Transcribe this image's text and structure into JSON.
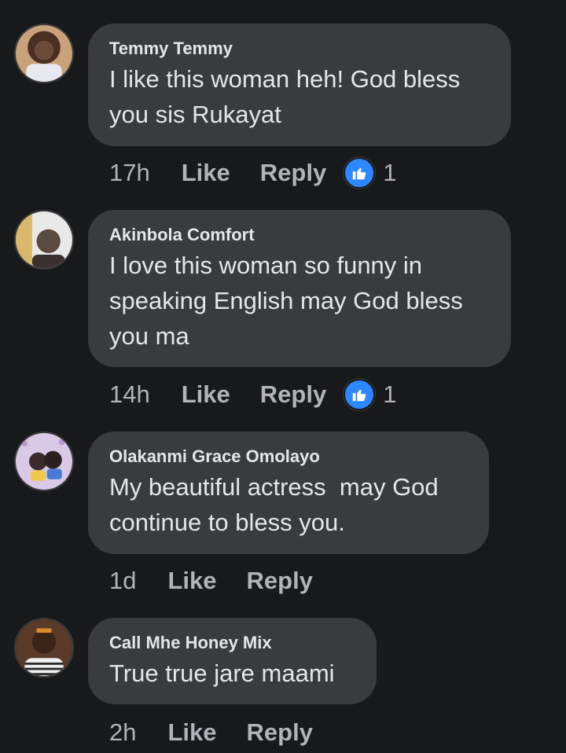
{
  "comments": [
    {
      "author": "Temmy Temmy",
      "text": "I like this woman heh! God bless\nyou sis Rukayat",
      "time": "17h",
      "like_label": "Like",
      "reply_label": "Reply",
      "reaction_icon": "like-reaction-icon",
      "reaction_count": "1",
      "avatar_colors": [
        "#6b4a3a",
        "#c9a27a"
      ]
    },
    {
      "author": "Akinbola Comfort",
      "text": "I love this woman so funny in\nspeaking English may God bless\nyou ma",
      "time": "14h",
      "like_label": "Like",
      "reply_label": "Reply",
      "reaction_icon": "like-reaction-icon",
      "reaction_count": "1",
      "avatar_colors": [
        "#e9e9e9",
        "#5a4a40"
      ]
    },
    {
      "author": "Olakanmi Grace Omolayo",
      "text": "My beautiful actress  may God\ncontinue to bless you.",
      "time": "1d",
      "like_label": "Like",
      "reply_label": "Reply",
      "avatar_colors": [
        "#d9c8e6",
        "#3a2a2a"
      ]
    },
    {
      "author": "Call Mhe Honey Mix",
      "text": "True true jare maami",
      "time": "2h",
      "like_label": "Like",
      "reply_label": "Reply",
      "avatar_colors": [
        "#3a2418",
        "#d98a2a"
      ]
    }
  ],
  "colors": {
    "background": "#18191a",
    "bubble": "#3a3b3c",
    "text": "#e4e6eb",
    "meta": "#b0b3b8",
    "reaction_blue": "#2d88ff"
  }
}
